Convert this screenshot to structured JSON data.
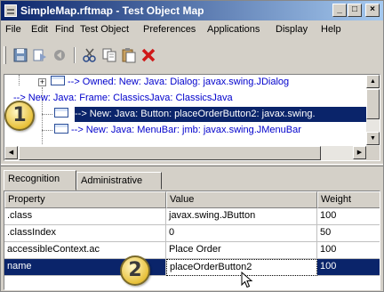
{
  "window": {
    "title": "SimpleMap.rftmap - Test Object Map",
    "controls": {
      "minimize": "_",
      "maximize": "□",
      "close": "×"
    }
  },
  "menus": [
    "File",
    "Edit",
    "Find",
    "Test Object",
    "Preferences",
    "Applications",
    "Display",
    "Help"
  ],
  "toolbar": {
    "icons": [
      "save-icon",
      "merge-icon",
      "back-icon",
      "cut-icon",
      "copy-icon",
      "paste-icon",
      "delete-icon"
    ],
    "delete_color": "#d01818"
  },
  "tree": {
    "nodes": [
      {
        "text": "--> Owned: New: Java: Dialog: javax.swing.JDialog",
        "selected": false,
        "icon": "window-icon"
      },
      {
        "text": "--> New: Java: Frame: ClassicsJava: ClassicsJava",
        "selected": false,
        "icon": "window-icon"
      },
      {
        "text": "--> New: Java: Button: placeOrderButton2: javax.swing.",
        "selected": true,
        "icon": "window-icon"
      },
      {
        "text": "--> New: Java: MenuBar: jmb: javax.swing.JMenuBar",
        "selected": false,
        "icon": "window-icon"
      }
    ]
  },
  "tabs": [
    {
      "label": "Recognition",
      "active": true
    },
    {
      "label": "Administrative",
      "active": false
    }
  ],
  "grid": {
    "headers": [
      "Property",
      "Value",
      "Weight"
    ],
    "rows": [
      {
        "property": ".class",
        "value": "javax.swing.JButton",
        "weight": "100"
      },
      {
        "property": ".classIndex",
        "value": "0",
        "weight": "50"
      },
      {
        "property": "accessibleContext.ac",
        "value": "Place Order",
        "weight": "100"
      },
      {
        "property": "name",
        "value": "placeOrderButton2",
        "weight": "100"
      }
    ],
    "selected_row": 3
  },
  "callouts": [
    "1",
    "2"
  ],
  "colors": {
    "selection": "#0a246a",
    "tree_text": "#0000cc",
    "callout": "#e8c13a"
  }
}
